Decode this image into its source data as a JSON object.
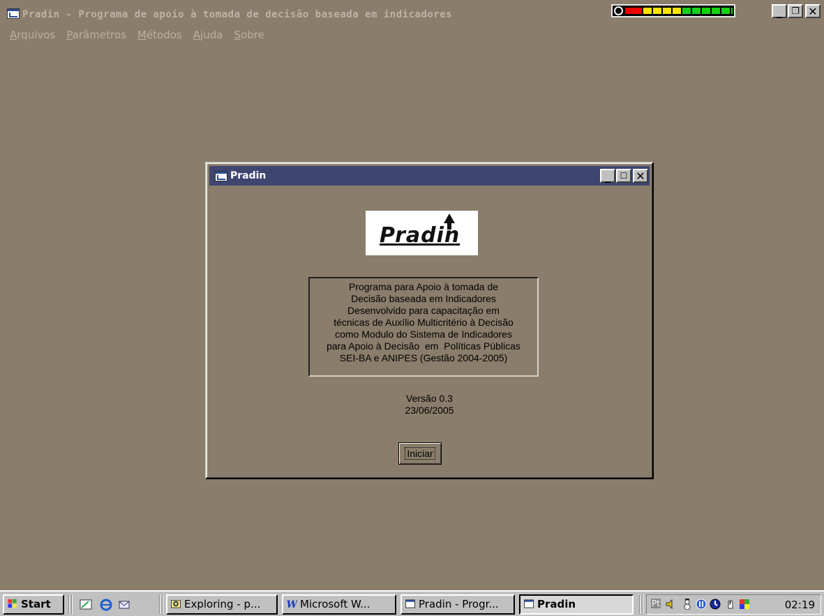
{
  "main_window": {
    "title": "Pradin - Programa de apoio à tomada de decisão baseada em indicadores",
    "meter_icon": "volume-meter"
  },
  "menu": {
    "items": [
      {
        "accel": "A",
        "rest": "rquivos"
      },
      {
        "accel": "P",
        "rest": "arâmetros"
      },
      {
        "accel": "M",
        "rest": "étodos"
      },
      {
        "accel": "A",
        "rest": "juda"
      },
      {
        "accel": "S",
        "rest": "obre"
      }
    ]
  },
  "dialog": {
    "title": "Pradin",
    "logo_text": "Pradin",
    "description_lines": [
      "Programa para Apoio à tomada de",
      "Decisão baseada em Indicadores",
      "Desenvolvido para capacitação em",
      "técnicas de Auxílio Multicritério à Decisão",
      "como Modulo do Sistema de Indicadores",
      "para Apoio à Decisão  em  Políticas Públicas",
      "SEI-BA e ANIPES (Gestão 2004-2005)"
    ],
    "version": "Versão 0.3",
    "date": "23/06/2005",
    "start_button": "Iniciar"
  },
  "taskbar": {
    "start": "Start",
    "tasks": [
      {
        "label": "Exploring - p..."
      },
      {
        "label": "Microsoft W..."
      },
      {
        "label": "Pradin - Progr..."
      },
      {
        "label": "Pradin"
      }
    ],
    "tray_lang": "Pt",
    "clock": "02:19"
  },
  "colors": {
    "desktop": "#8a7d6b",
    "dialog_title": "#3e4670",
    "taskbar": "#c0c0c0"
  }
}
